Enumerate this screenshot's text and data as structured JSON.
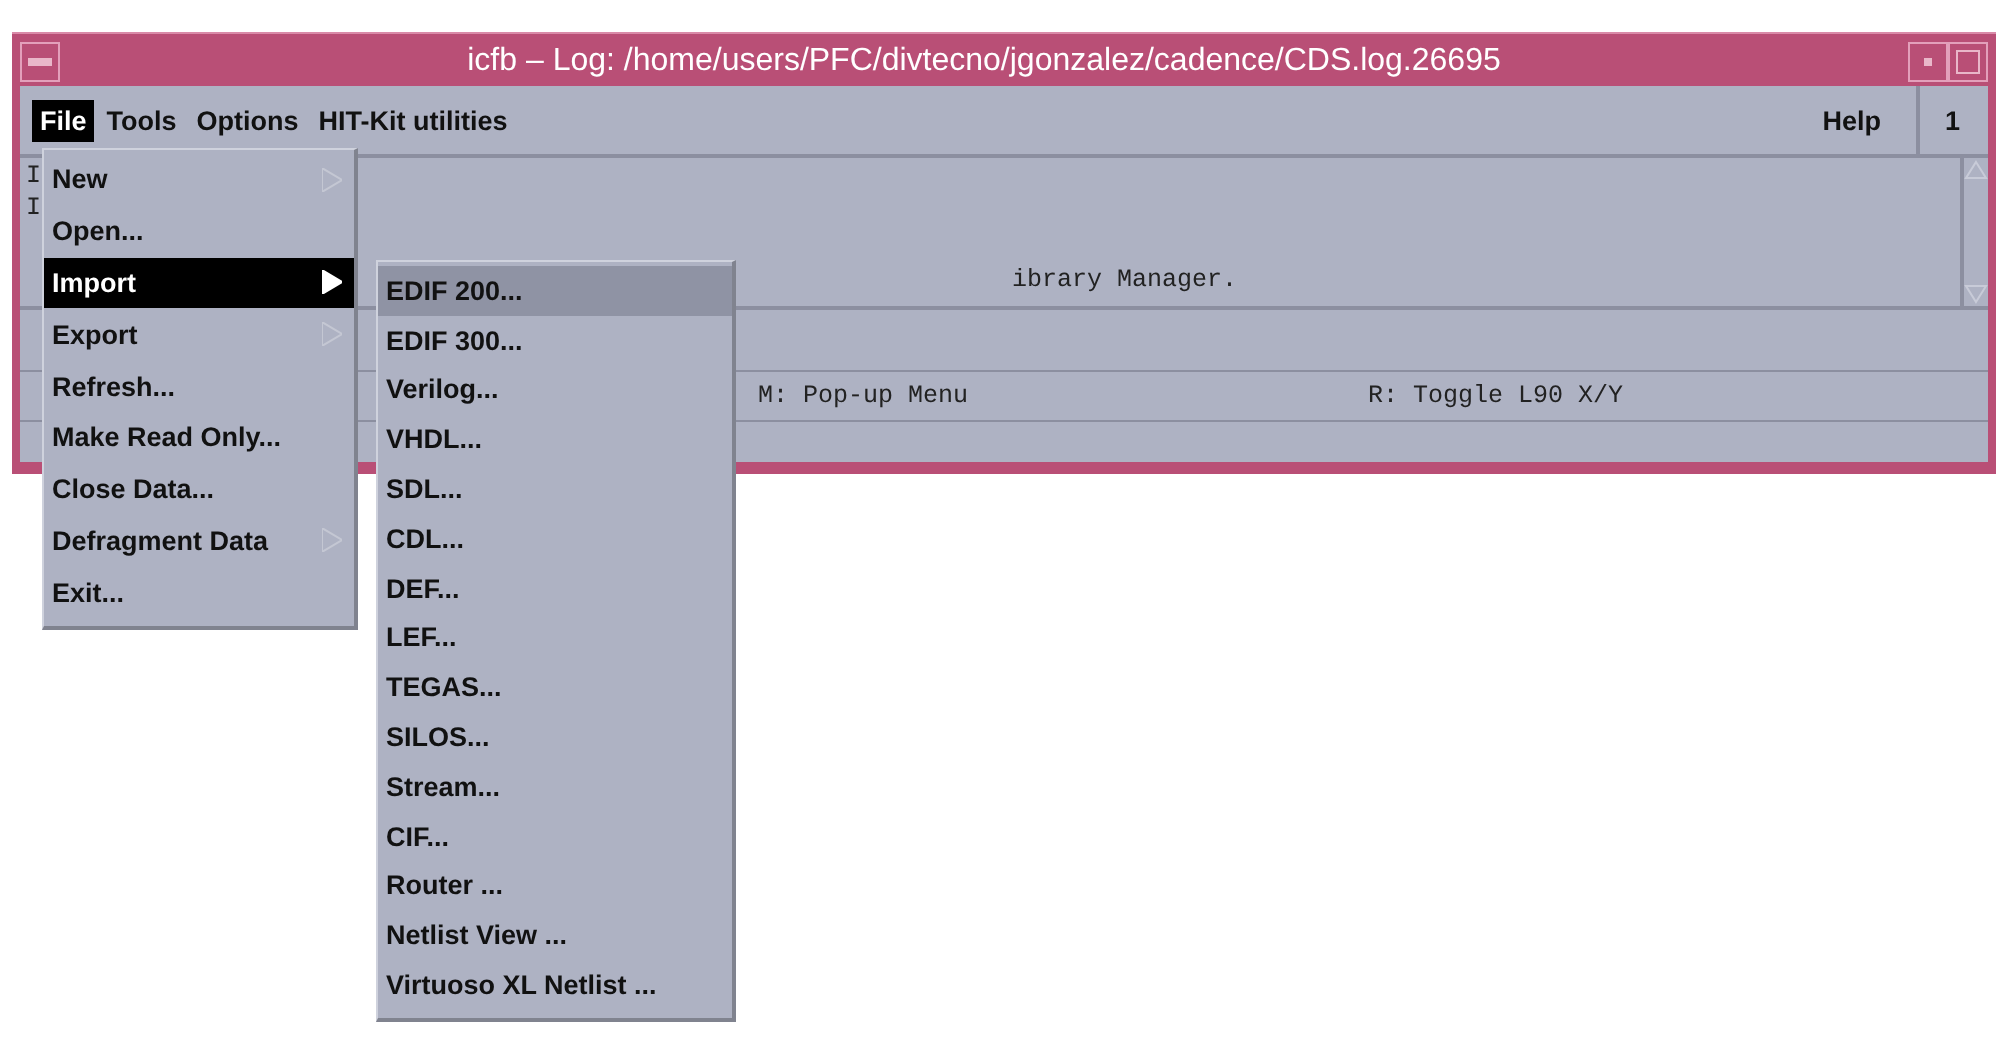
{
  "window": {
    "title": "icfb – Log: /home/users/PFC/divtecno/jgonzalez/cadence/CDS.log.26695"
  },
  "menubar": {
    "items": [
      {
        "label": "File",
        "selected": true
      },
      {
        "label": "Tools",
        "selected": false
      },
      {
        "label": "Options",
        "selected": false
      },
      {
        "label": "HIT-Kit utilities",
        "selected": false
      }
    ],
    "help": "Help",
    "number": "1"
  },
  "log": {
    "lines": [
      "I",
      "I",
      "ibrary Manager."
    ]
  },
  "status_bar": {
    "left": "M: Pop-up Menu",
    "right": "R: Toggle L90 X/Y"
  },
  "file_menu": {
    "items": [
      {
        "label": "New",
        "submenu": true,
        "selected": false
      },
      {
        "label": "Open...",
        "submenu": false,
        "selected": false
      },
      {
        "label": "Import",
        "submenu": true,
        "selected": true
      },
      {
        "label": "Export",
        "submenu": true,
        "selected": false
      },
      {
        "label": "Refresh...",
        "submenu": false,
        "selected": false
      },
      {
        "label": "Make Read Only...",
        "submenu": false,
        "selected": false
      },
      {
        "label": "Close Data...",
        "submenu": false,
        "selected": false
      },
      {
        "label": "Defragment Data",
        "submenu": true,
        "selected": false
      },
      {
        "label": "Exit...",
        "submenu": false,
        "selected": false
      }
    ]
  },
  "import_menu": {
    "items": [
      {
        "label": "EDIF 200...",
        "selected": true
      },
      {
        "label": "EDIF 300...",
        "selected": false
      },
      {
        "label": "Verilog...",
        "selected": false
      },
      {
        "label": "VHDL...",
        "selected": false
      },
      {
        "label": "SDL...",
        "selected": false
      },
      {
        "label": "CDL...",
        "selected": false
      },
      {
        "label": "DEF...",
        "selected": false
      },
      {
        "label": "LEF...",
        "selected": false
      },
      {
        "label": "TEGAS...",
        "selected": false
      },
      {
        "label": "SILOS...",
        "selected": false
      },
      {
        "label": "Stream...",
        "selected": false
      },
      {
        "label": "CIF...",
        "selected": false
      },
      {
        "label": "Router ...",
        "selected": false
      },
      {
        "label": "Netlist View ...",
        "selected": false
      },
      {
        "label": "Virtuoso XL Netlist ...",
        "selected": false
      }
    ]
  }
}
